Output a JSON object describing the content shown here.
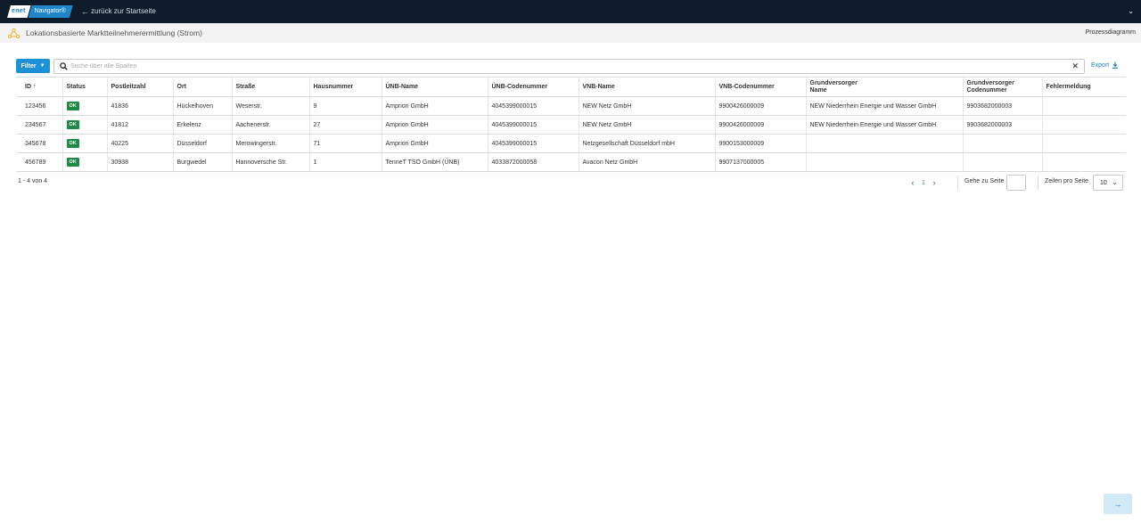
{
  "topbar": {
    "logo_left": "enet",
    "logo_right": "Navigator®",
    "back_label": "zurück zur Startseite",
    "back_arrow": "🡐",
    "user_menu_icon": "chevron-down-icon"
  },
  "titlebar": {
    "title": "Lokationsbasierte Marktteilnehmerermittlung (Strom)",
    "process_label": "Prozessdiagramm",
    "icon": "network-icon",
    "icon_color": "#f0b429"
  },
  "toolbar": {
    "filter_label": "Filter",
    "search_placeholder": "Suche über alle Spalten",
    "search_value": "",
    "clear_label": "✕",
    "export_label": "Export"
  },
  "table": {
    "columns": [
      "ID ↑",
      "Status",
      "Postleitzahl",
      "Ort",
      "Straße",
      "Hausnummer",
      "ÜNB-Name",
      "ÜNB-Codenummer",
      "VNB-Name",
      "VNB-Codenummer",
      [
        "Grundversorger",
        "Name"
      ],
      [
        "Grundversorger",
        "Codenummer"
      ],
      "Fehlermeldung"
    ],
    "rows": [
      [
        "123456",
        "OK",
        "41836",
        "Hückelhoven",
        "Weserstr.",
        "9",
        "Amprion GmbH",
        "4045399000015",
        "NEW Netz GmbH",
        "9900426000009",
        "NEW Niederrhein Energie und Wasser GmbH",
        "9903682000003",
        ""
      ],
      [
        "234567",
        "OK",
        "41812",
        "Erkelenz",
        "Aachenerstr.",
        "27",
        "Amprion GmbH",
        "4045399000015",
        "NEW Netz GmbH",
        "9900426000009",
        "NEW Niederrhein Energie und Wasser GmbH",
        "9903682000003",
        ""
      ],
      [
        "345678",
        "OK",
        "40225",
        "Düsseldorf",
        "Merowingerstr.",
        "71",
        "Amprion GmbH",
        "4045399000015",
        "Netzgesellschaft Düsseldorf mbH",
        "9900153000009",
        "",
        "",
        ""
      ],
      [
        "456789",
        "OK",
        "30938",
        "Burgwedel",
        "Hannoversche Str.",
        "1",
        "TenneT TSO GmbH (ÜNB)",
        "4033872000058",
        "Avacon Netz GmbH",
        "9907137000005",
        "",
        "",
        ""
      ]
    ],
    "status_color": "#1d8b45"
  },
  "footer": {
    "count_label": "1 - 4 von 4",
    "prev_icon": "‹",
    "current_page": "1",
    "next_icon": "›",
    "goto_label": "Gehe zu Seite",
    "goto_value": "",
    "rows_label": "Zeilen pro Seite",
    "rows_value": "10",
    "next_step_icon": "→"
  },
  "colors": {
    "topbar": "#0d1b2a",
    "accent": "#1e90d6",
    "link": "#1e7fc8"
  }
}
